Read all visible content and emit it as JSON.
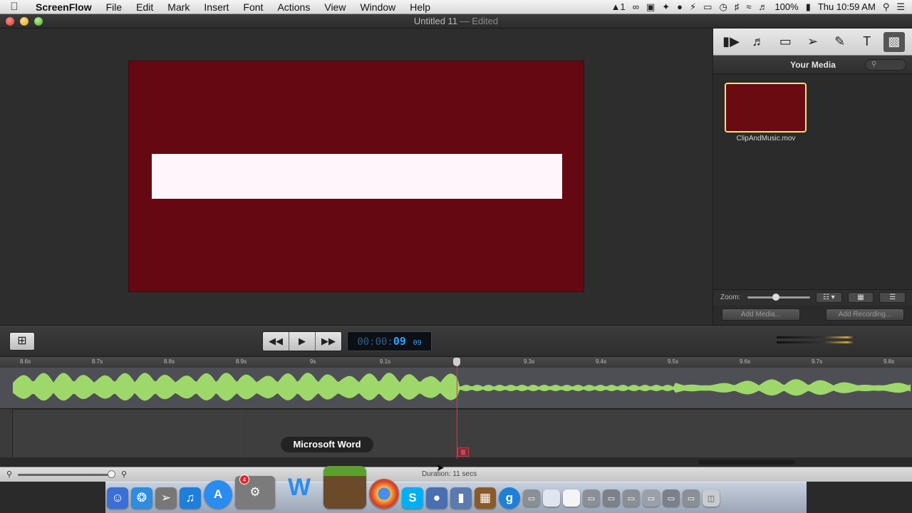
{
  "menubar": {
    "app_name": "ScreenFlow",
    "items": [
      "File",
      "Edit",
      "Mark",
      "Insert",
      "Font",
      "Actions",
      "View",
      "Window",
      "Help"
    ],
    "status": {
      "adobe_label": "1",
      "battery": "100%",
      "clock": "Thu 10:59 AM"
    }
  },
  "window": {
    "title": "Untitled 11",
    "state": "Edited",
    "separator": "—"
  },
  "canvas": {
    "frame_color": "#650812",
    "bar_color": "#fff6fb"
  },
  "inspector": {
    "tabs": [
      "video-camera-icon",
      "audio-speaker-icon",
      "screen-icon",
      "callout-cursor-icon",
      "annotations-pen-icon",
      "text-icon",
      "media-library-icon"
    ],
    "active_tab": "media-library-icon"
  },
  "media": {
    "title": "Your Media",
    "item_name": "ClipAndMusic.mov",
    "zoom_label": "Zoom:",
    "zoom_value": 0.45,
    "add_media": "Add Media...",
    "add_recording": "Add Recording..."
  },
  "transport": {
    "timecode_dim": "00:00:",
    "timecode_main": "09",
    "timecode_frames": "09"
  },
  "timeline": {
    "ticks": [
      "8.6s",
      "8.7s",
      "8.8s",
      "8.9s",
      "9s",
      "9.1s",
      "9.3s",
      "9.4s",
      "9.5s",
      "9.6s",
      "9.7s",
      "9.8s"
    ],
    "duration": "Duration: 11 secs",
    "waveform_color": "#9fd86a"
  },
  "dock": {
    "tooltip": "Microsoft Word",
    "badge": "4"
  }
}
